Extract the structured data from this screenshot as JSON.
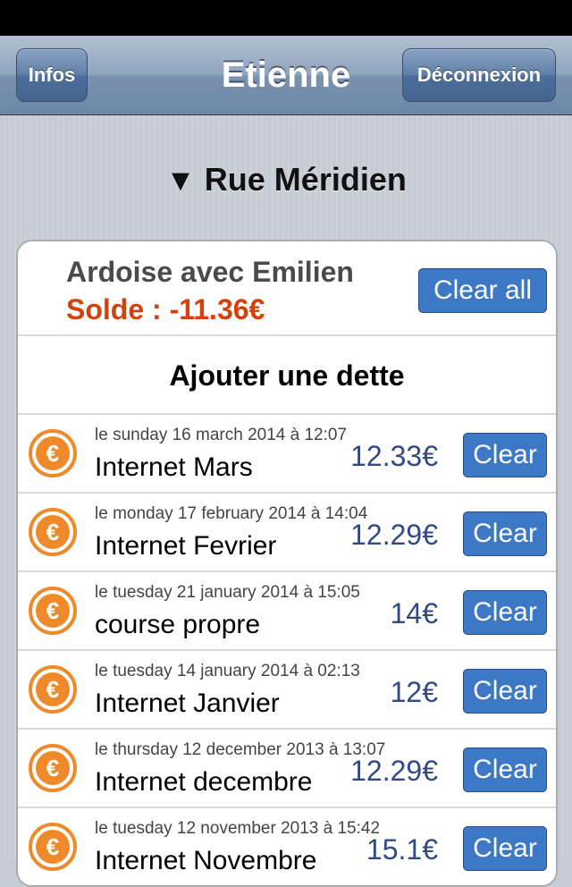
{
  "nav": {
    "title": "Etienne",
    "left_button": "Infos",
    "right_button": "Déconnexion"
  },
  "section": {
    "arrow": "▼",
    "title": "Rue Méridien"
  },
  "summary": {
    "title": "Ardoise avec Emilien",
    "balance": "Solde : -11.36€",
    "clear_all": "Clear all"
  },
  "add_debt": "Ajouter une dette",
  "debts": [
    {
      "date": "le sunday 16 march 2014 à 12:07",
      "label": "Internet Mars",
      "amount": "12.33€",
      "clear": "Clear"
    },
    {
      "date": "le monday 17 february 2014 à 14:04",
      "label": "Internet Fevrier",
      "amount": "12.29€",
      "clear": "Clear"
    },
    {
      "date": "le tuesday 21 january 2014 à 15:05",
      "label": "course propre",
      "amount": "14€",
      "clear": "Clear"
    },
    {
      "date": "le tuesday 14 january 2014 à 02:13",
      "label": "Internet Janvier",
      "amount": "12€",
      "clear": "Clear"
    },
    {
      "date": "le thursday 12 december 2013 à 13:07",
      "label": "Internet decembre",
      "amount": "12.29€",
      "clear": "Clear"
    },
    {
      "date": "le tuesday 12 november 2013 à 15:42",
      "label": "Internet Novembre",
      "amount": "15.1€",
      "clear": "Clear"
    }
  ],
  "icons": {
    "debt": "euro-icon"
  },
  "colors": {
    "balance": "#d4420c",
    "amount": "#2f4a87",
    "button": "#3c78c6",
    "euro": "#ee8a2a"
  }
}
